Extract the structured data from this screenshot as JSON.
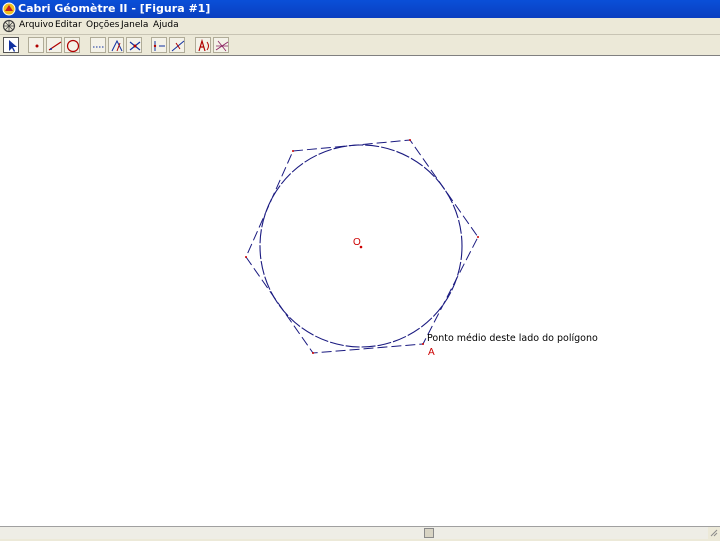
{
  "window": {
    "title": "Cabri Géomètre II - [Figura #1]"
  },
  "menu": {
    "items": [
      "Arquivo",
      "Editar",
      "Opções",
      "Janela",
      "Ajuda"
    ]
  },
  "toolbar": {
    "tools": [
      {
        "name": "pointer-tool-button",
        "icon": "arrow-pointer-icon"
      },
      {
        "name": "point-tool-button",
        "icon": "point-icon"
      },
      {
        "name": "line-tool-button",
        "icon": "line-icon"
      },
      {
        "name": "curve-tool-button",
        "icon": "circle-icon"
      },
      {
        "name": "construct-tool-button",
        "icon": "dotted-line-icon"
      },
      {
        "name": "transform-tool-button",
        "icon": "transform-icon"
      },
      {
        "name": "macro-tool-button",
        "icon": "macro-icon"
      },
      {
        "name": "check-property-tool-button",
        "icon": "check-property-icon"
      },
      {
        "name": "measure-tool-button",
        "icon": "measure-icon"
      },
      {
        "name": "display-tool-button",
        "icon": "label-icon"
      },
      {
        "name": "draw-tool-button",
        "icon": "draw-icon"
      }
    ]
  },
  "canvas": {
    "center_label": "O",
    "point_label": "A",
    "tooltip": "Ponto médio deste lado do polígono",
    "colors": {
      "circle": "#1a1a80",
      "polygon": "#1a1a80",
      "point": "#cc0000",
      "label": "#cc0000"
    }
  }
}
